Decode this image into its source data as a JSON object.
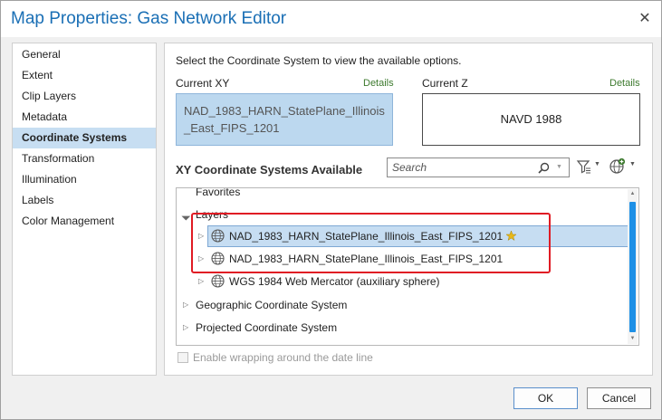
{
  "window": {
    "title": "Map Properties: Gas Network Editor",
    "close_glyph": "✕"
  },
  "nav": {
    "items": [
      {
        "label": "General",
        "selected": false
      },
      {
        "label": "Extent",
        "selected": false
      },
      {
        "label": "Clip Layers",
        "selected": false
      },
      {
        "label": "Metadata",
        "selected": false
      },
      {
        "label": "Coordinate Systems",
        "selected": true
      },
      {
        "label": "Transformation",
        "selected": false
      },
      {
        "label": "Illumination",
        "selected": false
      },
      {
        "label": "Labels",
        "selected": false
      },
      {
        "label": "Color Management",
        "selected": false
      }
    ]
  },
  "main": {
    "instruction": "Select the Coordinate System to view the available options.",
    "current_xy": {
      "label": "Current XY",
      "details": "Details",
      "value": "NAD_1983_HARN_StatePlane_Illinois_East_FIPS_1201"
    },
    "current_z": {
      "label": "Current Z",
      "details": "Details",
      "value": "NAVD 1988"
    },
    "section_heading": "XY Coordinate Systems Available",
    "search": {
      "placeholder": "Search"
    },
    "tree": {
      "favorites": "Favorites",
      "layers": "Layers",
      "layer_items": [
        "NAD_1983_HARN_StatePlane_Illinois_East_FIPS_1201",
        "NAD_1983_HARN_StatePlane_Illinois_East_FIPS_1201",
        "WGS 1984 Web Mercator (auxiliary sphere)"
      ],
      "geographic": "Geographic Coordinate System",
      "projected": "Projected Coordinate System"
    },
    "wrap_checkbox": {
      "label": "Enable wrapping around the date line",
      "checked": false
    }
  },
  "buttons": {
    "ok": "OK",
    "cancel": "Cancel"
  },
  "colors": {
    "title": "#1a6fb5",
    "selection": "#c7def2",
    "details_link": "#3d7a2e",
    "annotation": "#e01b24",
    "scroll_thumb": "#1e90e6"
  },
  "icons": {
    "close": "close-icon",
    "search": "search-icon",
    "filter": "filter-icon",
    "add": "add-coordinate-system-icon",
    "globe": "globe-icon",
    "favorite": "favorite-star-icon"
  }
}
